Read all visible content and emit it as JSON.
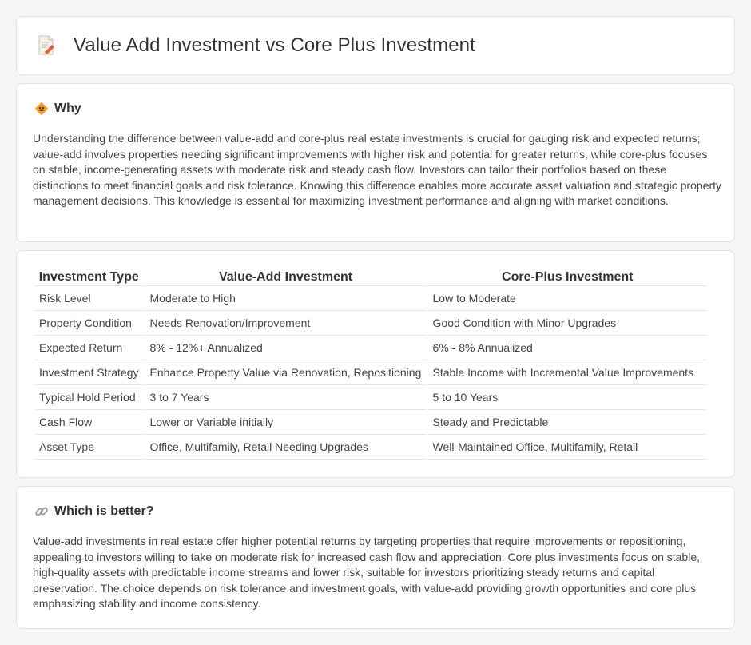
{
  "page": {
    "title": "Value Add Investment vs Core Plus Investment"
  },
  "why": {
    "heading": "Why",
    "icon": "diamond-sign-icon",
    "text": "Understanding the difference between value-add and core-plus real estate investments is crucial for gauging risk and expected returns; value-add involves properties needing significant improvements with higher risk and potential for greater returns, while core-plus focuses on stable, income-generating assets with moderate risk and steady cash flow. Investors can tailor their portfolios based on these distinctions to meet financial goals and risk tolerance. Knowing this difference enables more accurate asset valuation and strategic property management decisions. This knowledge is essential for maximizing investment performance and aligning with market conditions."
  },
  "table": {
    "headers": [
      "Investment Type",
      "Value-Add Investment",
      "Core-Plus Investment"
    ],
    "rows": [
      [
        "Risk Level",
        "Moderate to High",
        "Low to Moderate"
      ],
      [
        "Property Condition",
        "Needs Renovation/Improvement",
        "Good Condition with Minor Upgrades"
      ],
      [
        "Expected Return",
        "8% - 12%+ Annualized",
        "6% - 8% Annualized"
      ],
      [
        "Investment Strategy",
        "Enhance Property Value via Renovation, Repositioning",
        "Stable Income with Incremental Value Improvements"
      ],
      [
        "Typical Hold Period",
        "3 to 7 Years",
        "5 to 10 Years"
      ],
      [
        "Cash Flow",
        "Lower or Variable initially",
        "Steady and Predictable"
      ],
      [
        "Asset Type",
        "Office, Multifamily, Retail Needing Upgrades",
        "Well-Maintained Office, Multifamily, Retail"
      ]
    ]
  },
  "better": {
    "heading": "Which is better?",
    "icon": "link-icon",
    "text": "Value-add investments in real estate offer higher potential returns by targeting properties that require improvements or repositioning, appealing to investors willing to take on moderate risk for increased cash flow and appreciation. Core plus investments focus on stable, high-quality assets with predictable income streams and lower risk, suitable for investors prioritizing steady returns and capital preservation. The choice depends on risk tolerance and investment goals, with value-add providing growth opportunities and core plus emphasizing stability and income consistency."
  },
  "colors": {
    "accent_orange": "#f0a030",
    "pencil_red": "#e8603c"
  }
}
